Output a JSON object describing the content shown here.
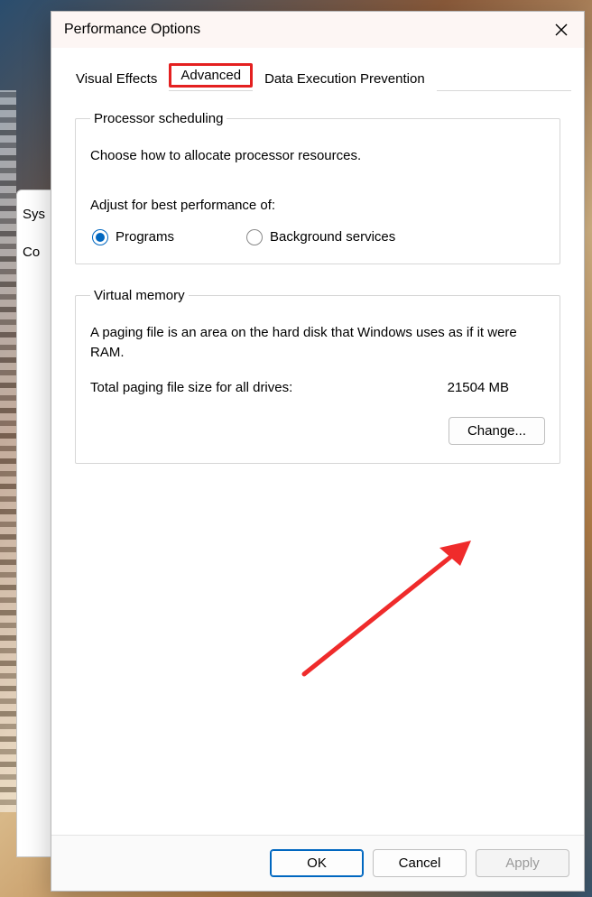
{
  "behind": {
    "label1": "Sys",
    "label2": "Co"
  },
  "dialog": {
    "title": "Performance Options",
    "tabs": {
      "visual": "Visual Effects",
      "advanced": "Advanced",
      "dep": "Data Execution Prevention"
    },
    "processor": {
      "legend": "Processor scheduling",
      "desc": "Choose how to allocate processor resources.",
      "subhead": "Adjust for best performance of:",
      "opt_programs": "Programs",
      "opt_bg": "Background services"
    },
    "vm": {
      "legend": "Virtual memory",
      "desc": "A paging file is an area on the hard disk that Windows uses as if it were RAM.",
      "total_label": "Total paging file size for all drives:",
      "total_value": "21504 MB",
      "change": "Change..."
    },
    "buttons": {
      "ok": "OK",
      "cancel": "Cancel",
      "apply": "Apply"
    }
  }
}
